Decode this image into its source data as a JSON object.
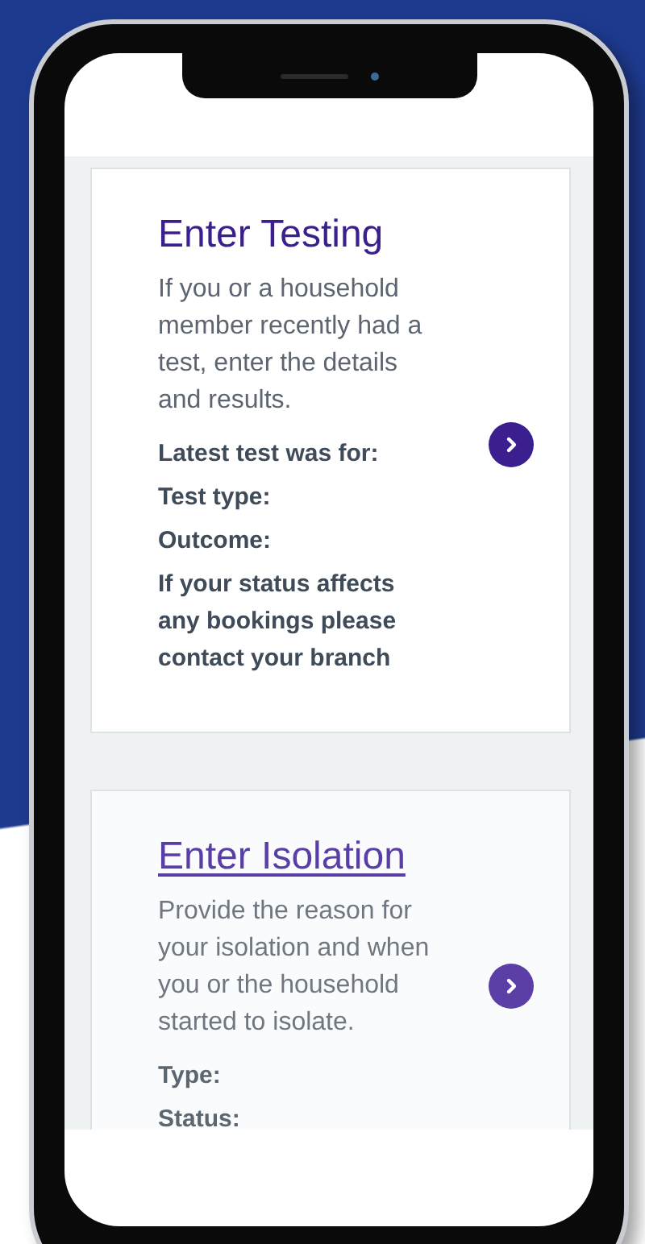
{
  "cards": [
    {
      "title": "Enter Testing",
      "hovered": false,
      "description": "If you or a household member recently had a test, enter the details and results.",
      "fields": [
        "Latest test was for:",
        "Test type:",
        "Outcome:",
        "If your status affects any bookings please contact your branch"
      ]
    },
    {
      "title": "Enter Isolation",
      "hovered": true,
      "description": "Provide the reason for your isolation and when you or the household started to isolate.",
      "fields": [
        "Type:",
        "Status:"
      ]
    }
  ]
}
